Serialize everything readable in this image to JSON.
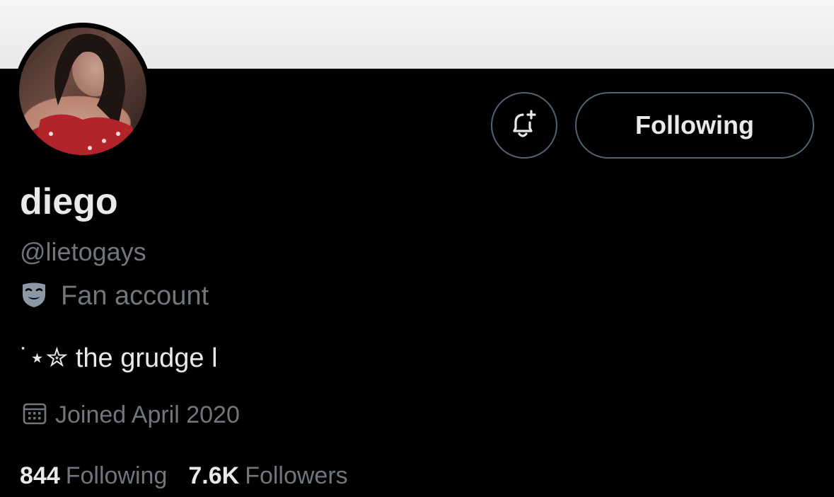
{
  "profile": {
    "display_name": "diego",
    "handle": "@lietogays",
    "label": "Fan account",
    "label_icon": "theater-masks-icon",
    "bio": "˙⋆✮ the grudge l",
    "joined": "Joined April 2020"
  },
  "actions": {
    "notify_icon": "bell-plus-icon",
    "follow_label": "Following"
  },
  "stats": {
    "following_count": "844",
    "following_label": "Following",
    "followers_count": "7.6K",
    "followers_label": "Followers"
  },
  "colors": {
    "background": "#000000",
    "primary_text": "#e7e9ea",
    "secondary_text": "#71767b",
    "border": "#536471"
  }
}
